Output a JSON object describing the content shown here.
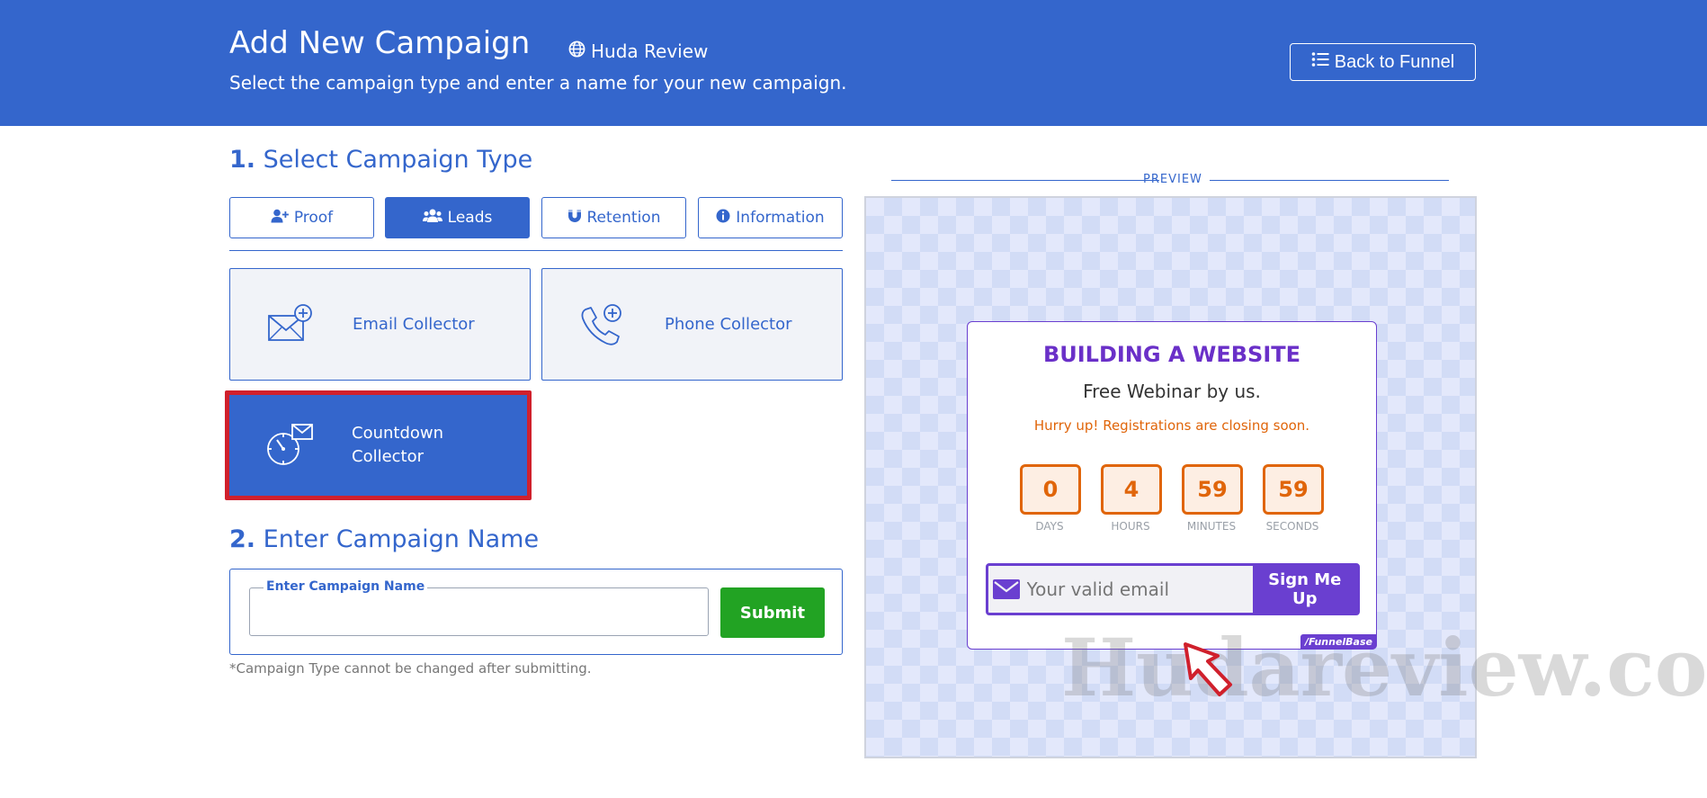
{
  "header": {
    "title": "Add New Campaign",
    "site_name": "Huda Review",
    "subtitle": "Select the campaign type and enter a name for your new campaign.",
    "back_button": "Back to Funnel",
    "bg_color": "#3466cc"
  },
  "step1": {
    "number": "1.",
    "title": "Select Campaign Type",
    "tabs": [
      {
        "label": "Proof",
        "icon": "user-plus-icon",
        "active": false
      },
      {
        "label": "Leads",
        "icon": "users-icon",
        "active": true
      },
      {
        "label": "Retention",
        "icon": "magnet-icon",
        "active": false
      },
      {
        "label": "Information",
        "icon": "info-circle-icon",
        "active": false
      }
    ],
    "collectors": [
      {
        "label": "Email Collector",
        "icon": "envelope-plus-icon",
        "selected": false
      },
      {
        "label": "Phone Collector",
        "icon": "phone-plus-icon",
        "selected": false
      },
      {
        "label": "Countdown Collector",
        "icon": "timer-envelope-icon",
        "selected": true
      }
    ]
  },
  "step2": {
    "number": "2.",
    "title": "Enter Campaign Name",
    "field_label": "Enter Campaign Name",
    "field_value": "",
    "submit": "Submit",
    "note": "*Campaign Type cannot be changed after submitting."
  },
  "preview": {
    "label": "PREVIEW",
    "popup": {
      "title": "BUILDING A WEBSITE",
      "subtitle": "Free Webinar by us.",
      "hurry": "Hurry up! Registrations are closing soon.",
      "countdown": [
        {
          "value": "0",
          "unit": "DAYS"
        },
        {
          "value": "4",
          "unit": "HOURS"
        },
        {
          "value": "59",
          "unit": "MINUTES"
        },
        {
          "value": "59",
          "unit": "SECONDS"
        }
      ],
      "email_placeholder": "Your valid email",
      "button": "Sign Me Up",
      "brand": "/FunnelBase"
    }
  },
  "watermark": "Hudareview.com",
  "colors": {
    "accent": "#3466cc",
    "success": "#22a323",
    "popup_accent": "#6a3fd0",
    "countdown": "#e0650a",
    "highlight": "#d0202c"
  }
}
